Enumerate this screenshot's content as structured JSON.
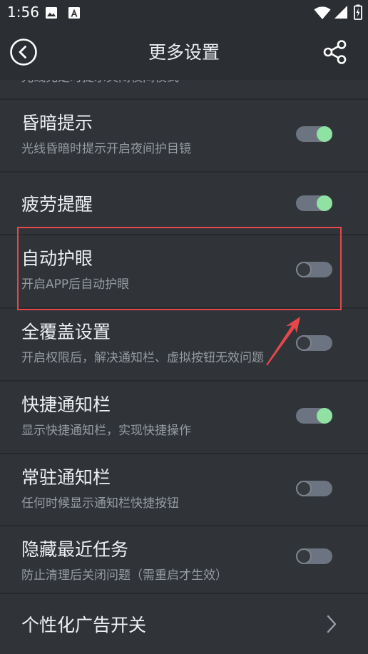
{
  "status_bar": {
    "time": "1:56"
  },
  "header": {
    "title": "更多设置"
  },
  "rows": [
    {
      "subtitle": "光线充足时提示关闭夜间模式"
    },
    {
      "title": "昏暗提示",
      "subtitle": "光线昏暗时提示开启夜间护目镜",
      "on": true
    },
    {
      "title": "疲劳提醒",
      "on": true
    },
    {
      "title": "自动护眼",
      "subtitle": "开启APP后自动护眼",
      "on": false
    },
    {
      "title": "全覆盖设置",
      "subtitle": "开启权限后，解决通知栏、虚拟按钮无效问题",
      "on": false
    },
    {
      "title": "快捷通知栏",
      "subtitle": "显示快捷通知栏，实现快捷操作",
      "on": true
    },
    {
      "title": "常驻通知栏",
      "subtitle": "任何时候显示通知栏快捷按钮",
      "on": false
    },
    {
      "title": "隐藏最近任务",
      "subtitle": "防止清理后关闭问题（需重启才生效）",
      "on": false
    },
    {
      "title": "个性化广告开关"
    }
  ],
  "icons": {
    "status_left": [
      "image-icon",
      "a-letter-icon"
    ],
    "status_right": [
      "wifi-icon",
      "cell-signal-icon",
      "battery-charging-icon"
    ],
    "back": "back-icon",
    "share": "share-icon",
    "row_arrow": "chevron-right-icon"
  },
  "colors": {
    "page_bg": "#303439",
    "bar_bg": "#2b2f33",
    "divider": "#26292d",
    "title_text": "#eef0f2",
    "subtitle_text": "#969ba1",
    "toggle_track": "#6b7480",
    "toggle_on": "#8fe2a2",
    "toggle_off_knob": "#363a3f",
    "highlight": "#e4484a"
  }
}
